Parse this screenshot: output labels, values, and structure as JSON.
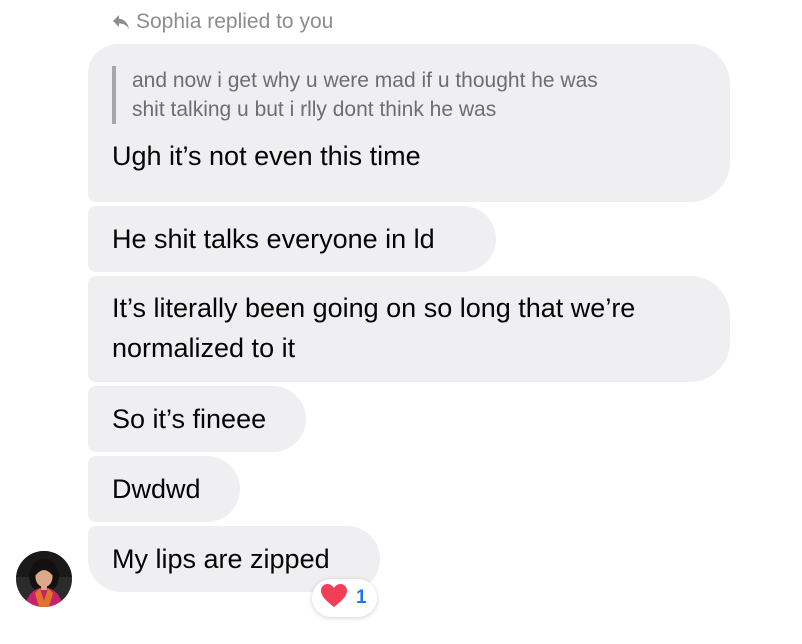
{
  "reply_header": {
    "text": "Sophia replied to you",
    "icon": "reply-arrow-icon"
  },
  "quoted_message": {
    "lines": [
      "and now i get why u were mad if u thought he was",
      "shit talking u but i rlly dont think he was"
    ]
  },
  "messages": [
    {
      "lines": [
        "Ugh it’s not even this time"
      ]
    },
    {
      "lines": [
        "He shit talks everyone in ld"
      ]
    },
    {
      "lines": [
        "It’s literally been going on so long that we’re",
        "normalized to it"
      ]
    },
    {
      "lines": [
        "So it’s fineee"
      ]
    },
    {
      "lines": [
        "Dwdwd"
      ]
    },
    {
      "lines": [
        "My lips are zipped"
      ]
    }
  ],
  "reaction": {
    "icon": "heart-icon",
    "count": "1",
    "color": "#f33e58"
  },
  "colors": {
    "bubble": "#efeef0",
    "meta_text": "#8a8d91",
    "reaction_count": "#1877f2"
  }
}
